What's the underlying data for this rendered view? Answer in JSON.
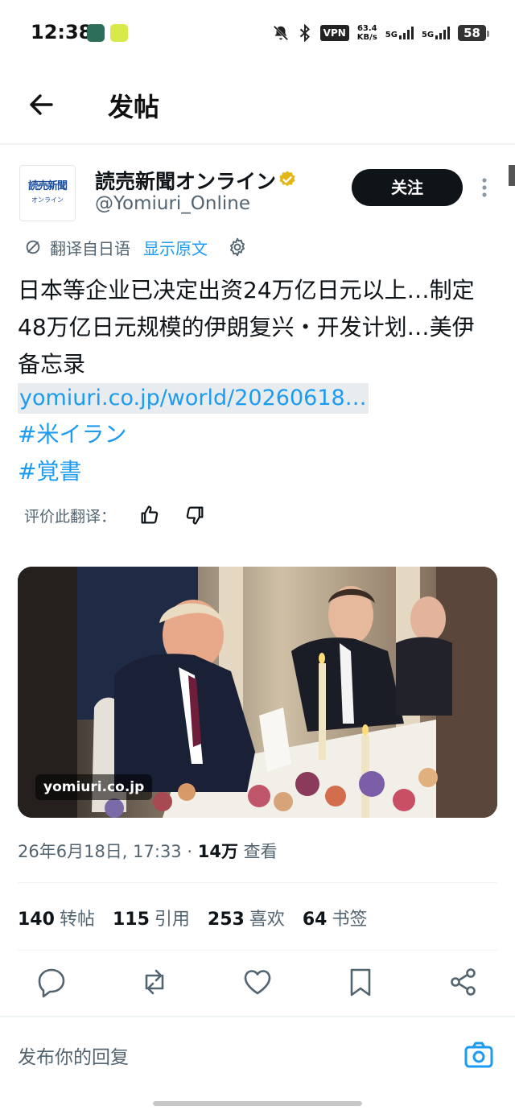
{
  "status_bar": {
    "time": "12:38",
    "vpn": "VPN",
    "speed_value": "63.4",
    "speed_unit": "KB/s",
    "signal1": "5G",
    "signal2": "5G",
    "battery": "58"
  },
  "header": {
    "title": "发帖",
    "back_icon": "arrow-left-icon"
  },
  "author": {
    "avatar_line1": "読売新聞",
    "avatar_line2": "オンライン",
    "name": "読売新聞オンライン",
    "handle": "@Yomiuri_Online",
    "follow_label": "关注"
  },
  "translation": {
    "label": "翻译自日语",
    "show_original": "显示原文",
    "rate_label": "评价此翻译："
  },
  "tweet": {
    "text": "日本等企业已决定出资24万亿日元以上…制定48万亿日元规模的伊朗复兴・开发计划…美伊备忘录",
    "link": "yomiuri.co.jp/world/20260618…",
    "hashtags": [
      "#米イラン",
      "#覚書"
    ],
    "media_source": "yomiuri.co.jp"
  },
  "meta": {
    "datetime": "26年6月18日, 17:33",
    "separator": "·",
    "views_count": "14万",
    "views_label": "查看"
  },
  "stats": [
    {
      "num": "140",
      "label": "转帖"
    },
    {
      "num": "115",
      "label": "引用"
    },
    {
      "num": "253",
      "label": "喜欢"
    },
    {
      "num": "64",
      "label": "书签"
    }
  ],
  "reply": {
    "placeholder": "发布你的回复"
  },
  "colors": {
    "accent": "#1d9bf0",
    "text": "#0f1419",
    "muted": "#536471",
    "verified": "#e2b719"
  }
}
